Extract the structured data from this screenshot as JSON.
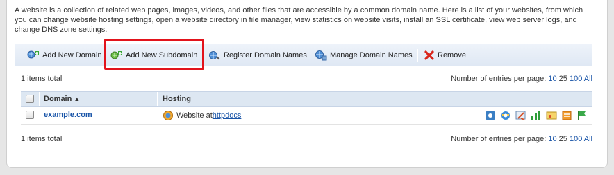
{
  "description": "A website is a collection of related web pages, images, videos, and other files that are accessible by a common domain name. Here is a list of your websites, from which you can change website hosting settings, open a website directory in file manager, view statistics on website visits, install an SSL certificate, view web server logs, and change DNS zone settings.",
  "toolbar": {
    "add_domain": "Add New Domain",
    "add_subdomain": "Add New Subdomain",
    "register_domains": "Register Domain Names",
    "manage_domains": "Manage Domain Names",
    "remove": "Remove"
  },
  "top_pager": {
    "count_text": "1 items total",
    "per_page_label": "Number of entries per page:",
    "opt_10": "10",
    "opt_25": "25",
    "opt_100": "100",
    "opt_all": "All"
  },
  "table": {
    "col_domain": "Domain",
    "sort_indicator": "▲",
    "col_hosting": "Hosting",
    "rows": [
      {
        "domain": "example.com",
        "hosting_prefix": "Website at ",
        "hosting_link": "httpdocs"
      }
    ]
  },
  "bottom_pager": {
    "count_text": "1 items total",
    "per_page_label": "Number of entries per page:",
    "opt_10": "10",
    "opt_25": "25",
    "opt_100": "100",
    "opt_all": "All"
  },
  "colors": {
    "highlight": "#e2131b",
    "link": "#1a55a8",
    "toolbar_bg": "#dfe8f4"
  },
  "row_action_icons": [
    "open-site-icon",
    "ie-browser-icon",
    "settings-tools-icon",
    "statistics-icon",
    "ssl-certificate-icon",
    "logs-icon",
    "dns-flag-icon"
  ]
}
